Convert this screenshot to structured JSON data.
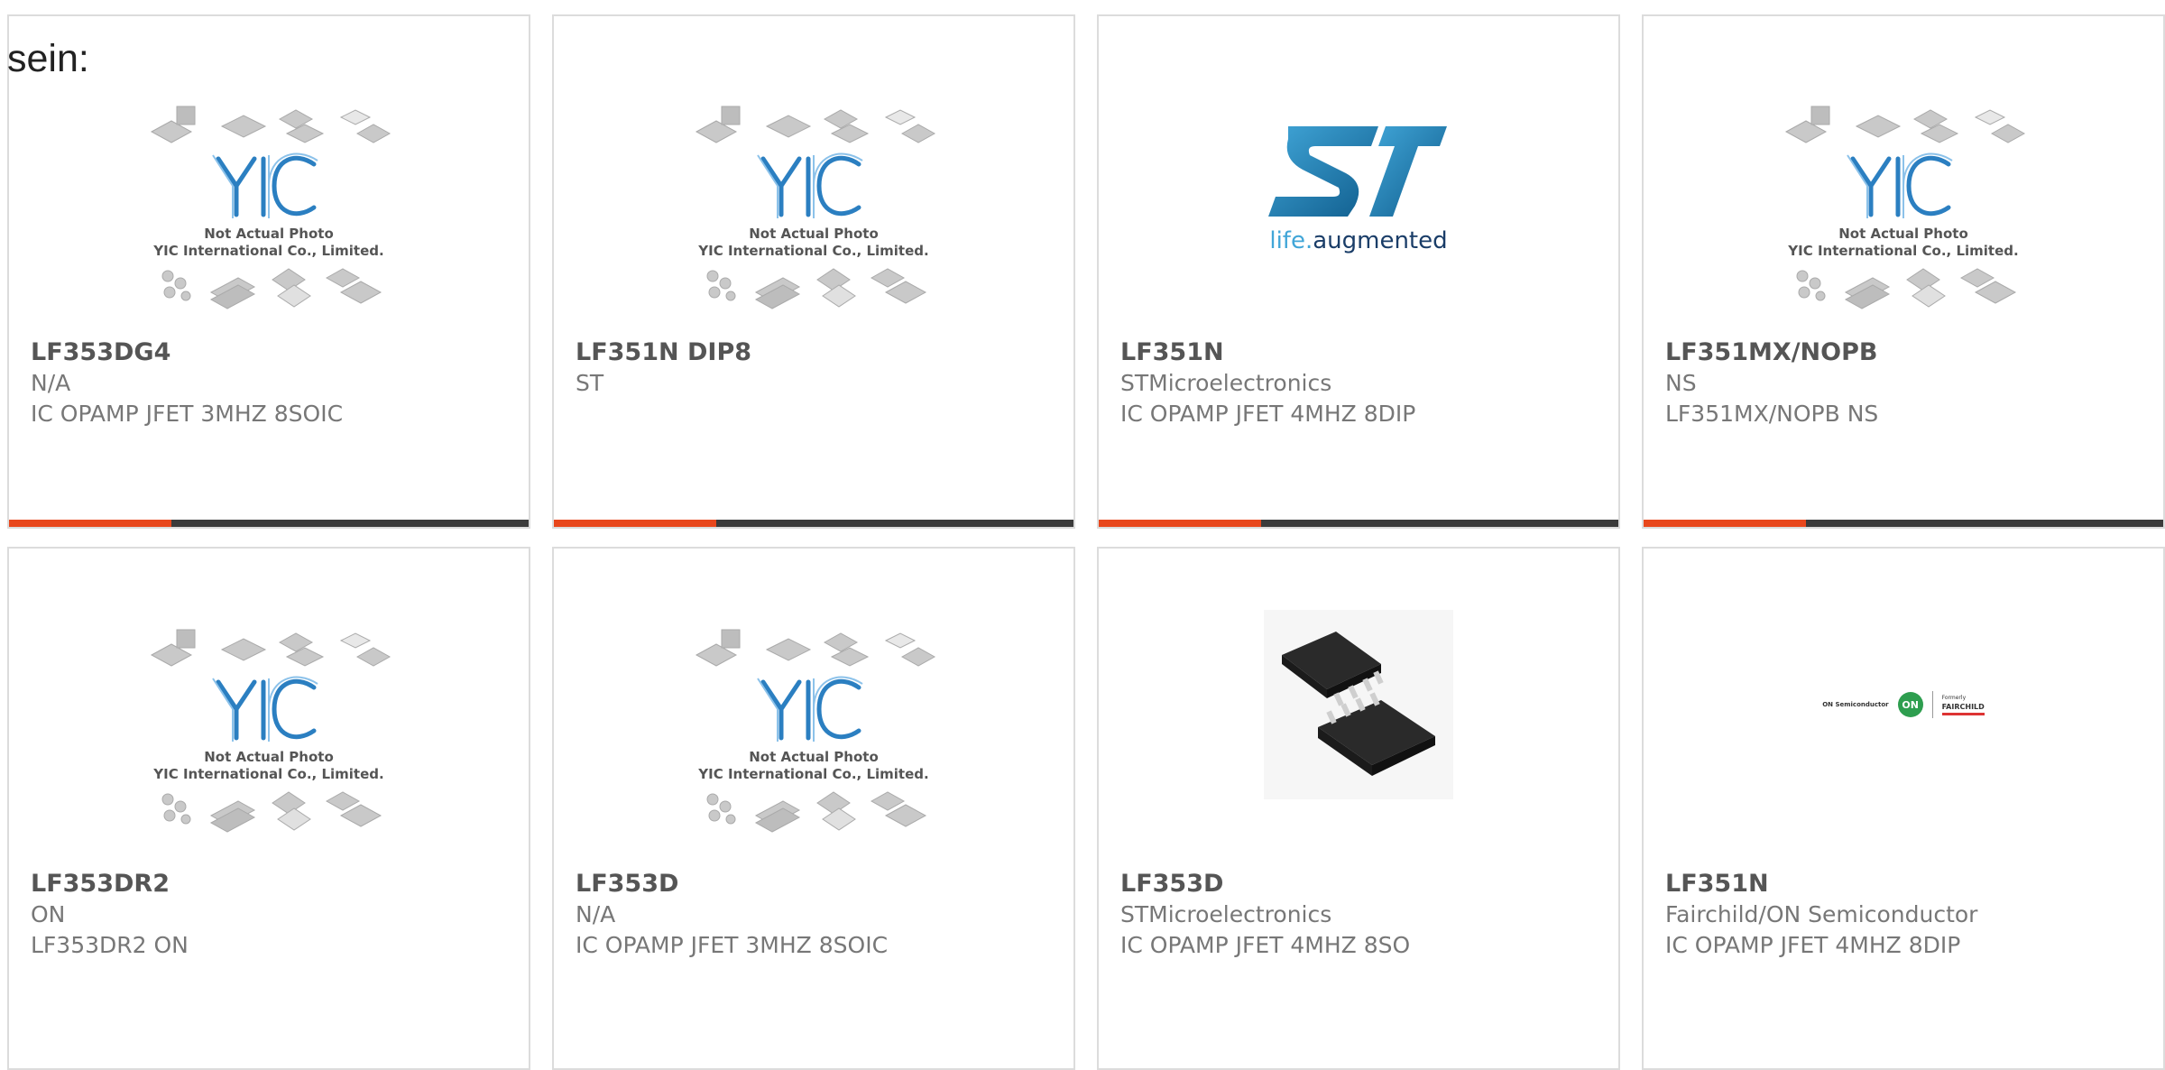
{
  "heading": "sein:",
  "colors": {
    "accent_bar": "#e8471c",
    "dark_bar": "#3b3b3b",
    "border": "#dcdcdc",
    "yic_blue": "#2b7fc1",
    "st_blue": "#1b72a8"
  },
  "placeholder": {
    "line1": "Not Actual Photo",
    "line2": "YIC International Co., Limited.",
    "logo_text": "YIC"
  },
  "st_logo": {
    "tagline_part1": "life",
    "tagline_part2": "augmented"
  },
  "on_logo": {
    "brand": "ON Semiconductor",
    "mark": "ON",
    "formerly": "Formerly",
    "fairchild": "FAIRCHILD"
  },
  "products": [
    {
      "part": "LF353DG4",
      "manufacturer": "N/A",
      "description": "IC OPAMP JFET 3MHZ 8SOIC",
      "image": "yic-placeholder"
    },
    {
      "part": "LF351N DIP8",
      "manufacturer": "ST",
      "description": "",
      "image": "yic-placeholder"
    },
    {
      "part": "LF351N",
      "manufacturer": "STMicroelectronics",
      "description": "IC OPAMP JFET 4MHZ 8DIP",
      "image": "st-logo"
    },
    {
      "part": "LF351MX/NOPB",
      "manufacturer": "NS",
      "description": "LF351MX/NOPB NS",
      "image": "yic-placeholder"
    },
    {
      "part": "LF353DR2",
      "manufacturer": "ON",
      "description": "LF353DR2 ON",
      "image": "yic-placeholder"
    },
    {
      "part": "LF353D",
      "manufacturer": "N/A",
      "description": "IC OPAMP JFET 3MHZ 8SOIC",
      "image": "yic-placeholder"
    },
    {
      "part": "LF353D",
      "manufacturer": "STMicroelectronics",
      "description": "IC OPAMP JFET 4MHZ 8SO",
      "image": "soic-chip-photo"
    },
    {
      "part": "LF351N",
      "manufacturer": "Fairchild/ON Semiconductor",
      "description": "IC OPAMP JFET 4MHZ 8DIP",
      "image": "on-fairchild-logo"
    }
  ]
}
